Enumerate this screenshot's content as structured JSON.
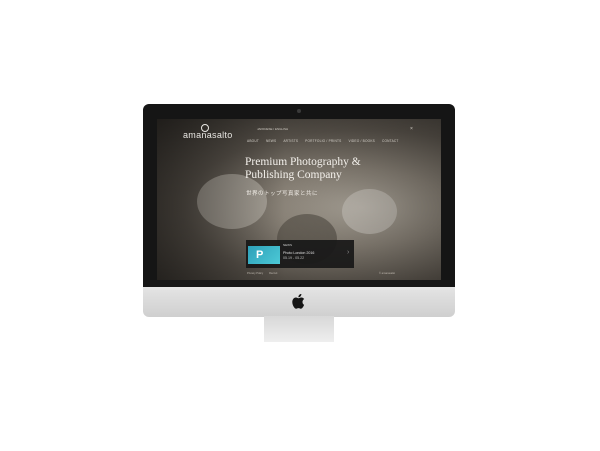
{
  "site": {
    "logo": "amanasalto",
    "lang": "JAPANESE / ENGLISH",
    "nav": [
      "ABOUT",
      "NEWS",
      "ARTISTS",
      "PORTFOLIO / PRINTS",
      "VIDEO / BOOKS",
      "CONTACT"
    ],
    "close": "×"
  },
  "hero": {
    "headline_line1": "Premium Photography &",
    "headline_line2": "Publishing Company",
    "subtitle": "世界のトップ写真家と共に"
  },
  "card": {
    "thumb_letter": "P",
    "tag": "NEWS",
    "title": "Photo London 2016",
    "date": "05.19 - 05.22",
    "arrow": "›"
  },
  "footer": {
    "left": [
      "Privacy Policy",
      "Recruit"
    ],
    "right": "© amanasalto"
  }
}
